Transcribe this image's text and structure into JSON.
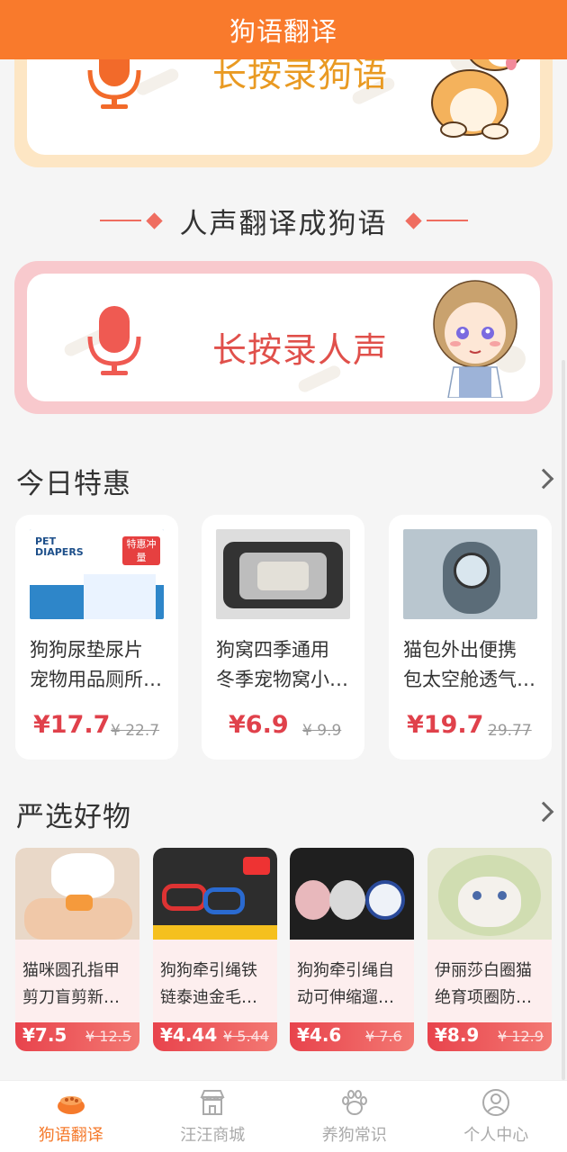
{
  "header": {
    "title": "狗语翻译"
  },
  "dog_record": {
    "label": "长按录狗语"
  },
  "divider": {
    "title": "人声翻译成狗语"
  },
  "human_record": {
    "label": "长按录人声"
  },
  "deals": {
    "title": "今日特惠",
    "items": [
      {
        "line1": "狗狗尿垫尿片",
        "line2": "宠物用品厕所…",
        "price": "¥17.7",
        "orig": "¥ 22.7",
        "img_text": "PET DIAPERS",
        "badge": "特惠冲量"
      },
      {
        "line1": "狗窝四季通用",
        "line2": "冬季宠物窝小…",
        "price": "¥6.9",
        "orig": "¥ 9.9"
      },
      {
        "line1": "猫包外出便携",
        "line2": "包太空舱透气…",
        "price": "¥19.7",
        "orig": "29.77"
      }
    ]
  },
  "picks": {
    "title": "严选好物",
    "items": [
      {
        "line1": "猫咪圆孔指甲",
        "line2": "剪刀盲剪新…",
        "price": "¥7.5",
        "orig": "¥ 12.5"
      },
      {
        "line1": "狗狗牵引绳铁",
        "line2": "链泰迪金毛…",
        "price": "¥4.44",
        "orig": "¥ 5.44"
      },
      {
        "line1": "狗狗牵引绳自",
        "line2": "动可伸缩遛…",
        "price": "¥4.6",
        "orig": "¥ 7.6"
      },
      {
        "line1": "伊丽莎白圈猫",
        "line2": "绝育项圈防…",
        "price": "¥8.9",
        "orig": "¥ 12.9"
      }
    ]
  },
  "tabs": [
    {
      "label": "狗语翻译",
      "icon": "dog-bowl-icon",
      "active": true
    },
    {
      "label": "汪汪商城",
      "icon": "shop-icon",
      "active": false
    },
    {
      "label": "养狗常识",
      "icon": "paw-icon",
      "active": false
    },
    {
      "label": "个人中心",
      "icon": "user-icon",
      "active": false
    }
  ],
  "colors": {
    "brand": "#f97a2c",
    "price": "#e0414b"
  }
}
